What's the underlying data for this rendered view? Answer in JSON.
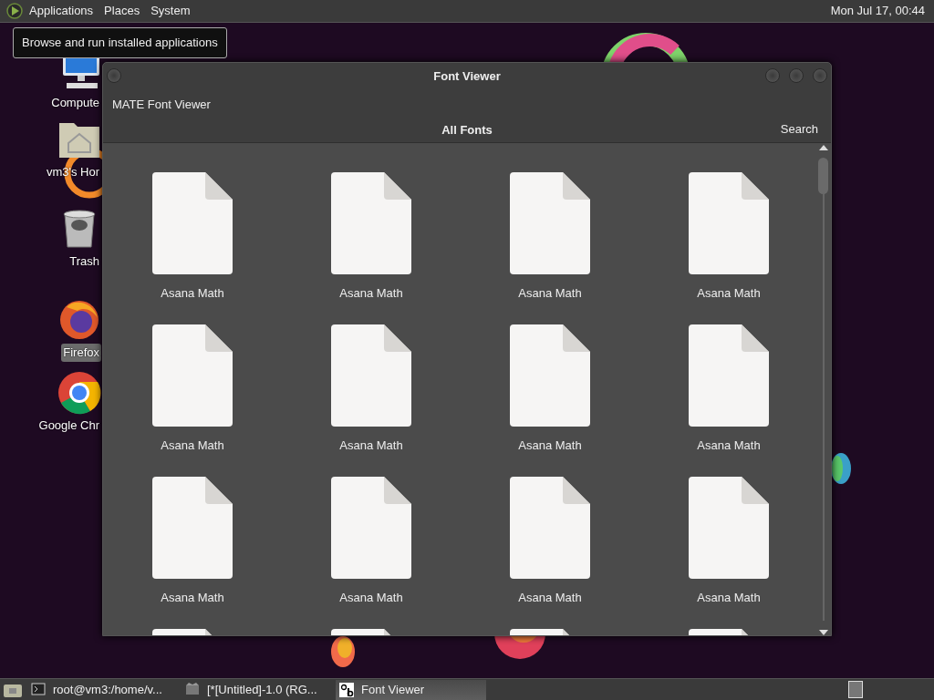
{
  "top_panel": {
    "menus": [
      {
        "label": "Applications"
      },
      {
        "label": "Places"
      },
      {
        "label": "System"
      }
    ],
    "clock": "Mon Jul 17, 00:44"
  },
  "tooltip": "Browse and run installed applications",
  "desktop_icons": [
    {
      "kind": "computer",
      "label": "Compute",
      "selected": false
    },
    {
      "kind": "home",
      "label": "vm3's Hor",
      "selected": false
    },
    {
      "kind": "trash",
      "label": "Trash",
      "selected": false
    },
    {
      "kind": "firefox",
      "label": "Firefox",
      "selected": true
    },
    {
      "kind": "chrome",
      "label": "Google Chr",
      "selected": false
    }
  ],
  "window": {
    "title": "Font Viewer",
    "app_name": "MATE Font Viewer",
    "heading": "All Fonts",
    "search_button": "Search",
    "fonts": [
      {
        "label": "Asana Math"
      },
      {
        "label": "Asana Math"
      },
      {
        "label": "Asana Math"
      },
      {
        "label": "Asana Math"
      },
      {
        "label": "Asana Math"
      },
      {
        "label": "Asana Math"
      },
      {
        "label": "Asana Math"
      },
      {
        "label": "Asana Math"
      },
      {
        "label": "Asana Math"
      },
      {
        "label": "Asana Math"
      },
      {
        "label": "Asana Math"
      },
      {
        "label": "Asana Math"
      },
      {
        "kind": "partial"
      },
      {
        "kind": "partial"
      },
      {
        "kind": "partial"
      },
      {
        "kind": "partial"
      }
    ]
  },
  "taskbar": {
    "tasks": [
      {
        "kind": "terminal",
        "label": "root@vm3:/home/v...",
        "selected": false
      },
      {
        "kind": "image",
        "label": "[*[Untitled]-1.0 (RG...",
        "selected": false
      },
      {
        "kind": "font",
        "label": "Font Viewer",
        "selected": true
      }
    ]
  }
}
